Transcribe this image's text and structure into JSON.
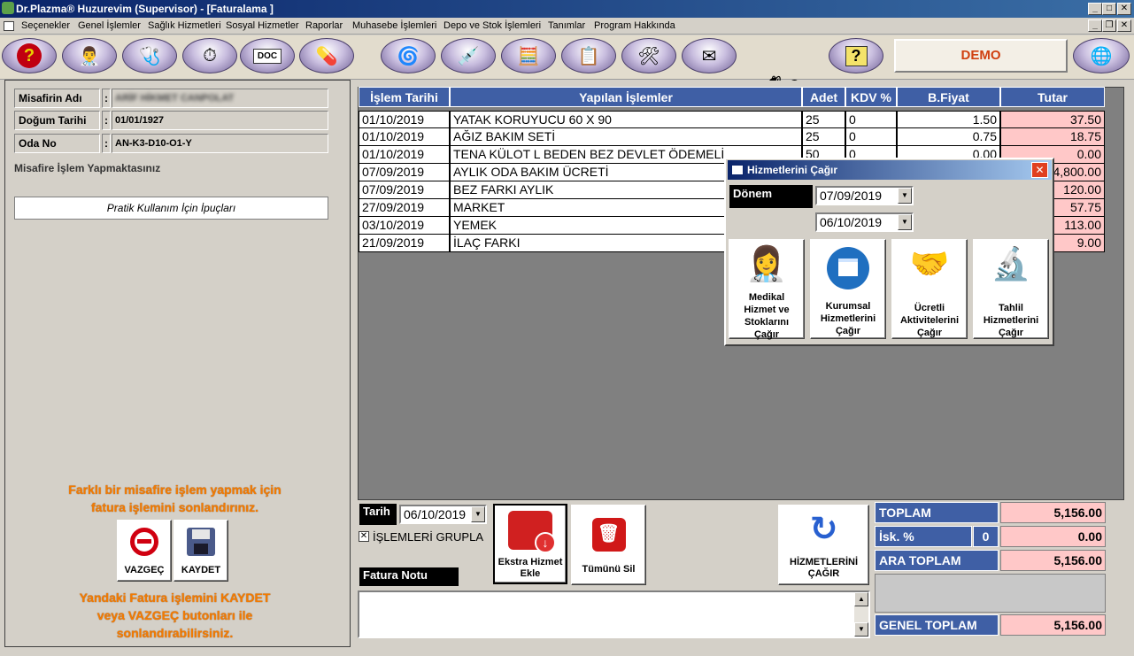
{
  "window": {
    "title": "Dr.Plazma® Huzurevim (Supervisor) - [Faturalama ]"
  },
  "menu": [
    "Seçenekler",
    "Genel İşlemler",
    "Sağlık Hizmetleri",
    "Sosyal Hizmetler",
    "Raporlar",
    "Muhasebe İşlemleri",
    "Depo ve Stok İşlemleri",
    "Tanımlar",
    "Program Hakkında"
  ],
  "toolbar": {
    "icons": [
      "help-head-icon",
      "doctors-icon",
      "medical-tools-icon",
      "stopwatch-icon",
      "word-doc-icon",
      "pills-icon",
      "spiral-icon",
      "syringe-icon",
      "calculator-icon",
      "checklist-icon",
      "tools-icon",
      "mail-icon",
      "squirrel-mascot-icon",
      "question-note-icon",
      "globe-icon"
    ],
    "question_glyph": "?",
    "doc_label": "DOC",
    "demo_label": "DEMO"
  },
  "guest": {
    "name_label": "Misafirin Adı",
    "name_value": "ARİF HİKMET CANPOLAT",
    "birth_label": "Doğum Tarihi",
    "birth_value": "01/01/1927",
    "room_label": "Oda No",
    "room_value": "AN-K3-D10-O1-Y",
    "colon": ":",
    "status_text": "Misafire İşlem Yapmaktasınız",
    "tips_button": "Pratik Kullanım İçin İpuçları"
  },
  "left_notes": {
    "top_line1": "Farklı bir misafire işlem yapmak için",
    "top_line2": "fatura işlemini sonlandırınız.",
    "bottom_line1": "Yandaki Fatura işlemini KAYDET",
    "bottom_line2": "veya VAZGEÇ butonları ile",
    "bottom_line3": "sonlandırabilirsiniz."
  },
  "actions": {
    "cancel_label": "VAZGEÇ",
    "save_label": "KAYDET",
    "extra_service_label": "Ekstra Hizmet Ekle",
    "delete_all_label": "Tümünü Sil",
    "call_services_label": "HİZMETLERİNİ ÇAĞIR"
  },
  "table": {
    "headers": [
      "İşlem Tarihi",
      "Yapılan İşlemler",
      "Adet",
      "KDV %",
      "B.Fiyat",
      "Tutar"
    ],
    "rows": [
      {
        "date": "01/10/2019",
        "item": "YATAK KORUYUCU 60 X 90",
        "qty": "25",
        "kdv": "0",
        "unit": "1.50",
        "total": "37.50"
      },
      {
        "date": "01/10/2019",
        "item": "AĞIZ BAKIM SETİ",
        "qty": "25",
        "kdv": "0",
        "unit": "0.75",
        "total": "18.75"
      },
      {
        "date": "01/10/2019",
        "item": "TENA KÜLOT L BEDEN BEZ DEVLET ÖDEMELİ",
        "qty": "50",
        "kdv": "0",
        "unit": "0.00",
        "total": "0.00"
      },
      {
        "date": "07/09/2019",
        "item": "AYLIK ODA BAKIM ÜCRETİ",
        "qty": "",
        "kdv": "",
        "unit": "",
        "total": "4,800.00"
      },
      {
        "date": "07/09/2019",
        "item": "BEZ FARKI AYLIK",
        "qty": "",
        "kdv": "",
        "unit": "",
        "total": "120.00"
      },
      {
        "date": "27/09/2019",
        "item": "MARKET",
        "qty": "",
        "kdv": "",
        "unit": "",
        "total": "57.75"
      },
      {
        "date": "03/10/2019",
        "item": "YEMEK",
        "qty": "",
        "kdv": "",
        "unit": "",
        "total": "113.00"
      },
      {
        "date": "21/09/2019",
        "item": "İLAÇ FARKI",
        "qty": "",
        "kdv": "",
        "unit": "",
        "total": "9.00"
      }
    ]
  },
  "dialog": {
    "title": "Hizmetlerini Çağır",
    "period_label": "Dönem",
    "start_date": "07/09/2019",
    "end_date": "06/10/2019",
    "buttons": [
      {
        "label": "Medikal Hizmet ve Stoklarını Çağır",
        "icon": "doctor-icon"
      },
      {
        "label": "Kurumsal Hizmetlerini Çağır",
        "icon": "calendar-icon"
      },
      {
        "label": "Ücretli Aktivitelerini Çağır",
        "icon": "people-circle-icon"
      },
      {
        "label": "Tahlil Hizmetlerini Çağır",
        "icon": "microscope-icon"
      }
    ],
    "close_glyph": "✕"
  },
  "bottom": {
    "date_label": "Tarih",
    "date_value": "06/10/2019",
    "group_label": "İŞLEMLERİ GRUPLA",
    "group_checked": true,
    "note_label": "Fatura Notu"
  },
  "summary": {
    "toplam_label": "TOPLAM",
    "toplam_value": "5,156.00",
    "isk_label": "İsk. %",
    "isk_percent": "0",
    "isk_value": "0.00",
    "ara_label": "ARA TOPLAM",
    "ara_value": "5,156.00",
    "genel_label": "GENEL TOPLAM",
    "genel_value": "5,156.00"
  }
}
